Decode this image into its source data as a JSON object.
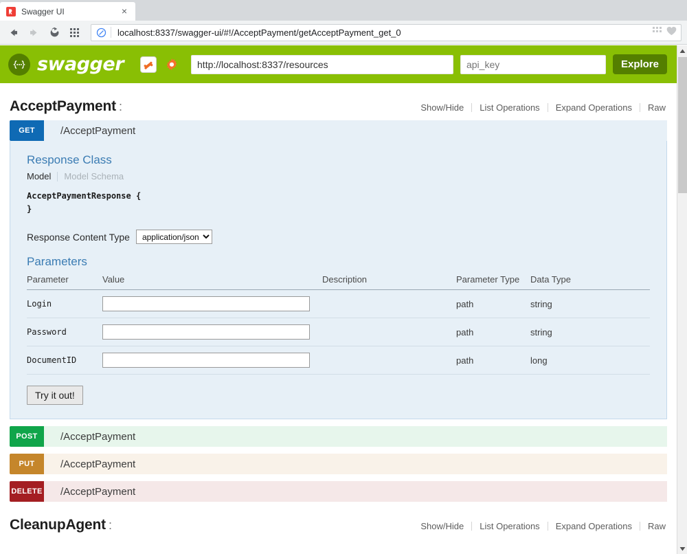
{
  "browser": {
    "tab": {
      "title": "Swagger UI",
      "favicon": "swagger-favicon",
      "close": "×"
    },
    "nav": {
      "back": "back-arrow",
      "forward": "forward-arrow",
      "reload": "reload",
      "apps": "apps-grid"
    },
    "url": "localhost:8337/swagger-ui/#!/AcceptPayment/getAcceptPayment_get_0"
  },
  "swagger_header": {
    "logo_text": "swagger",
    "api_url": "http://localhost:8337/resources",
    "api_key_placeholder": "api_key",
    "explore_label": "Explore",
    "brand_color": "#89bf04",
    "explore_color": "#547f00"
  },
  "resource_links": [
    {
      "label": "Show/Hide"
    },
    {
      "label": "List Operations"
    },
    {
      "label": "Expand Operations"
    },
    {
      "label": "Raw"
    }
  ],
  "resources": [
    {
      "name": "AcceptPayment",
      "colon": ":"
    },
    {
      "name": "CleanupAgent",
      "colon": ":"
    }
  ],
  "operations": [
    {
      "method": "GET",
      "path": "/AcceptPayment",
      "color": "#0f6ab4",
      "expanded": true
    },
    {
      "method": "POST",
      "path": "/AcceptPayment",
      "color": "#10a54a",
      "expanded": false
    },
    {
      "method": "PUT",
      "path": "/AcceptPayment",
      "color": "#c5862b",
      "expanded": false
    },
    {
      "method": "DELETE",
      "path": "/AcceptPayment",
      "color": "#a41e22",
      "expanded": false
    }
  ],
  "get_detail": {
    "response_class_title": "Response Class",
    "model_tab": "Model",
    "model_schema_tab": "Model Schema",
    "model_signature_open": "AcceptPaymentResponse {",
    "model_signature_close": "}",
    "content_type_label": "Response Content Type",
    "content_type_value": "application/json",
    "content_type_options": [
      "application/json"
    ],
    "parameters_title": "Parameters",
    "columns": [
      "Parameter",
      "Value",
      "Description",
      "Parameter Type",
      "Data Type"
    ],
    "rows": [
      {
        "parameter": "Login",
        "value": "",
        "description": "",
        "parameter_type": "path",
        "data_type": "string"
      },
      {
        "parameter": "Password",
        "value": "",
        "description": "",
        "parameter_type": "path",
        "data_type": "string"
      },
      {
        "parameter": "DocumentID",
        "value": "",
        "description": "",
        "parameter_type": "path",
        "data_type": "long"
      }
    ],
    "submit_label": "Try it out!"
  }
}
